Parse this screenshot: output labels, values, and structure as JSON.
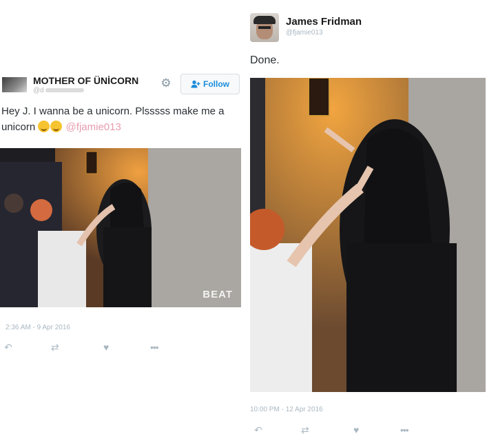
{
  "left_tweet": {
    "name": "MOTHER OF ÜNİCORN",
    "handle": "@d",
    "follow_label": "Follow",
    "text_main": "Hey J. I wanna be a unicorn. Plsssss make me a unicorn",
    "mention": "@fjamie013",
    "photo_watermark": "BEAT",
    "timestamp": "2:36 AM - 9 Apr 2016",
    "icons": {
      "gear": "gear-icon",
      "follow": "add-user-icon",
      "reply": "reply-icon",
      "retweet": "retweet-icon",
      "like": "heart-icon",
      "more": "more-icon"
    }
  },
  "right_tweet": {
    "name": "James Fridman",
    "handle": "@fjamie013",
    "text": "Done.",
    "timestamp": "10:00 PM - 12 Apr 2016"
  },
  "colors": {
    "link": "#1b8ddb",
    "mention": "#e89cae",
    "muted": "#aab8c2",
    "text": "#292f33"
  }
}
